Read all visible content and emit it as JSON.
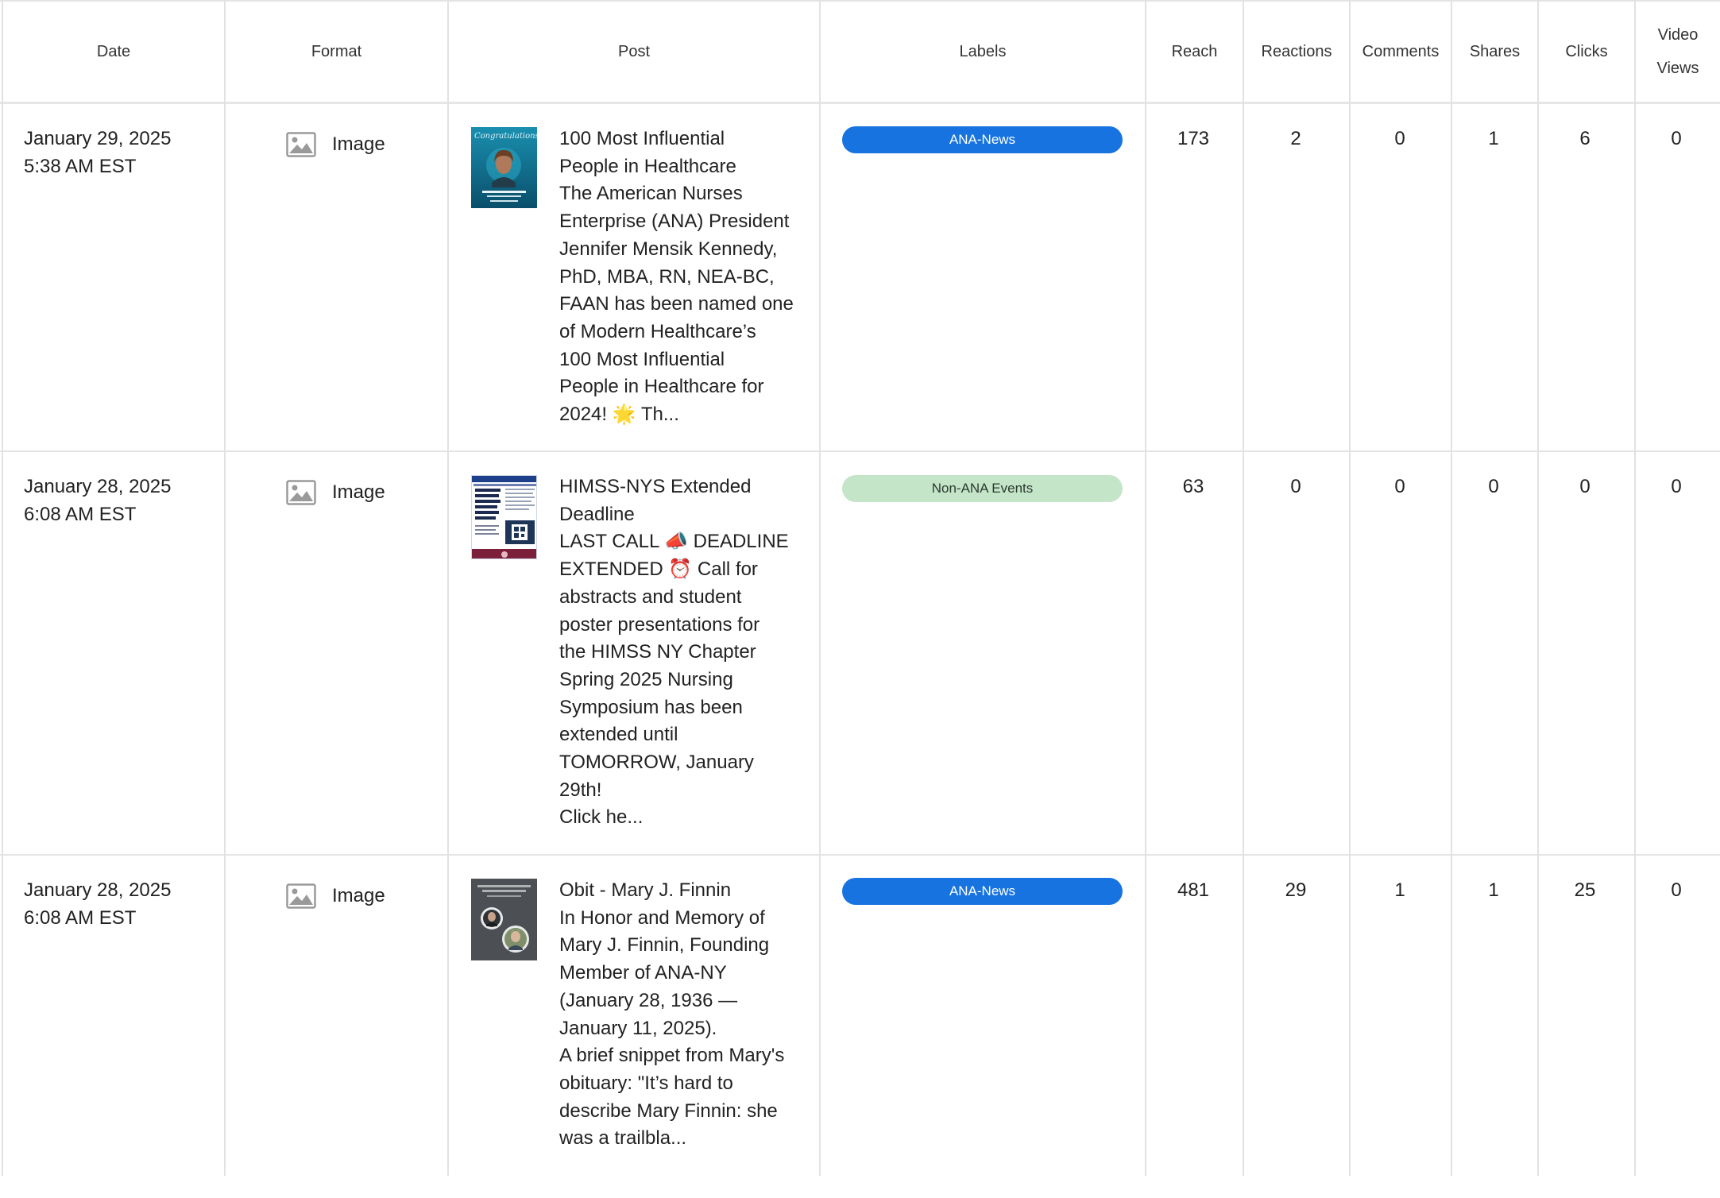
{
  "columns": {
    "date": "Date",
    "format": "Format",
    "post": "Post",
    "labels": "Labels",
    "reach": "Reach",
    "reactions": "Reactions",
    "comments": "Comments",
    "shares": "Shares",
    "clicks": "Clicks",
    "video_views_line1": "Video",
    "video_views_line2": "Views"
  },
  "colors": {
    "ana_news_pill": "#1673e0",
    "non_ana_events_pill": "#c4e5c8",
    "grid_line": "#e2e2e2"
  },
  "rows": [
    {
      "date": "January 29, 2025",
      "time": "5:38 AM EST",
      "format_icon": "image-icon",
      "format": "Image",
      "thumbnail": "congratulations-graphic",
      "thumbnail_text": "Congratulations!",
      "post_text": "100 Most Influential\nPeople in Healthcare\nThe American Nurses\nEnterprise (ANA) President\nJennifer Mensik Kennedy,\nPhD, MBA, RN, NEA-BC,\nFAAN has been named one\nof Modern Healthcare’s\n100 Most Influential\nPeople in Healthcare for\n2024! 🌟 Th...",
      "label": "ANA-News",
      "reach": "173",
      "reactions": "2",
      "comments": "0",
      "shares": "1",
      "clicks": "6",
      "video_views": "0"
    },
    {
      "date": "January 28, 2025",
      "time": "6:08 AM EST",
      "format_icon": "image-icon",
      "format": "Image",
      "thumbnail": "symposium-flyer",
      "thumbnail_text": "Frontline Guardians: How Nurses are Shaping the Future of Cyber Resilience",
      "post_text": "HIMSS-NYS Extended\nDeadline\nLAST CALL 📣 DEADLINE\nEXTENDED ⏰ Call for\nabstracts and student\nposter presentations for\nthe HIMSS NY Chapter\nSpring 2025 Nursing\nSymposium has been\nextended until\nTOMORROW, January\n29th!\nClick he...",
      "label": "Non-ANA Events",
      "reach": "63",
      "reactions": "0",
      "comments": "0",
      "shares": "0",
      "clicks": "0",
      "video_views": "0"
    },
    {
      "date": "January 28, 2025",
      "time": "6:08 AM EST",
      "format_icon": "image-icon",
      "format": "Image",
      "thumbnail": "memorial-graphic",
      "thumbnail_text": "In Honor and Memory of MARY J. FINNIN",
      "post_text": "Obit - Mary J. Finnin\nIn Honor and Memory of\nMary J. Finnin, Founding\nMember of ANA-NY\n(January 28, 1936 —\nJanuary 11, 2025).\nA brief snippet from Mary's\nobituary: \"It’s hard to\ndescribe Mary Finnin: she\nwas a trailbla...",
      "label": "ANA-News",
      "reach": "481",
      "reactions": "29",
      "comments": "1",
      "shares": "1",
      "clicks": "25",
      "video_views": "0"
    }
  ]
}
